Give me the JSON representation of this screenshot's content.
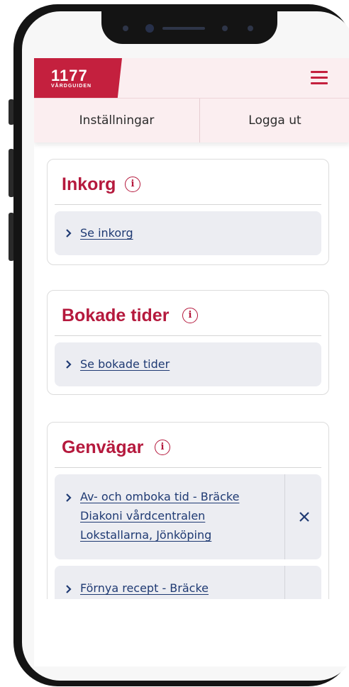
{
  "header": {
    "logo_number": "1177",
    "logo_subtitle": "VÅRDGUIDEN",
    "menu_icon": "hamburger-icon"
  },
  "subnav": {
    "settings_label": "Inställningar",
    "logout_label": "Logga ut"
  },
  "cards": {
    "inbox": {
      "title": "Inkorg",
      "info_icon": "i",
      "link": "Se inkorg"
    },
    "appointments": {
      "title": "Bokade tider",
      "info_icon": "i",
      "link": "Se bokade tider"
    },
    "shortcuts": {
      "title": "Genvägar",
      "info_icon": "i",
      "items": [
        {
          "line1": "Av- och omboka tid - Bräcke",
          "line2": "Diakoni vårdcentralen",
          "line3": "Lokstallarna, Jönköping"
        },
        {
          "line1": "Förnya recept - Bräcke"
        }
      ]
    }
  },
  "colors": {
    "brand_red": "#c4203e",
    "title_red": "#b5193d",
    "link_blue": "#1f3a73",
    "header_bg": "#fbeef0",
    "link_box_bg": "#ecedf2"
  }
}
